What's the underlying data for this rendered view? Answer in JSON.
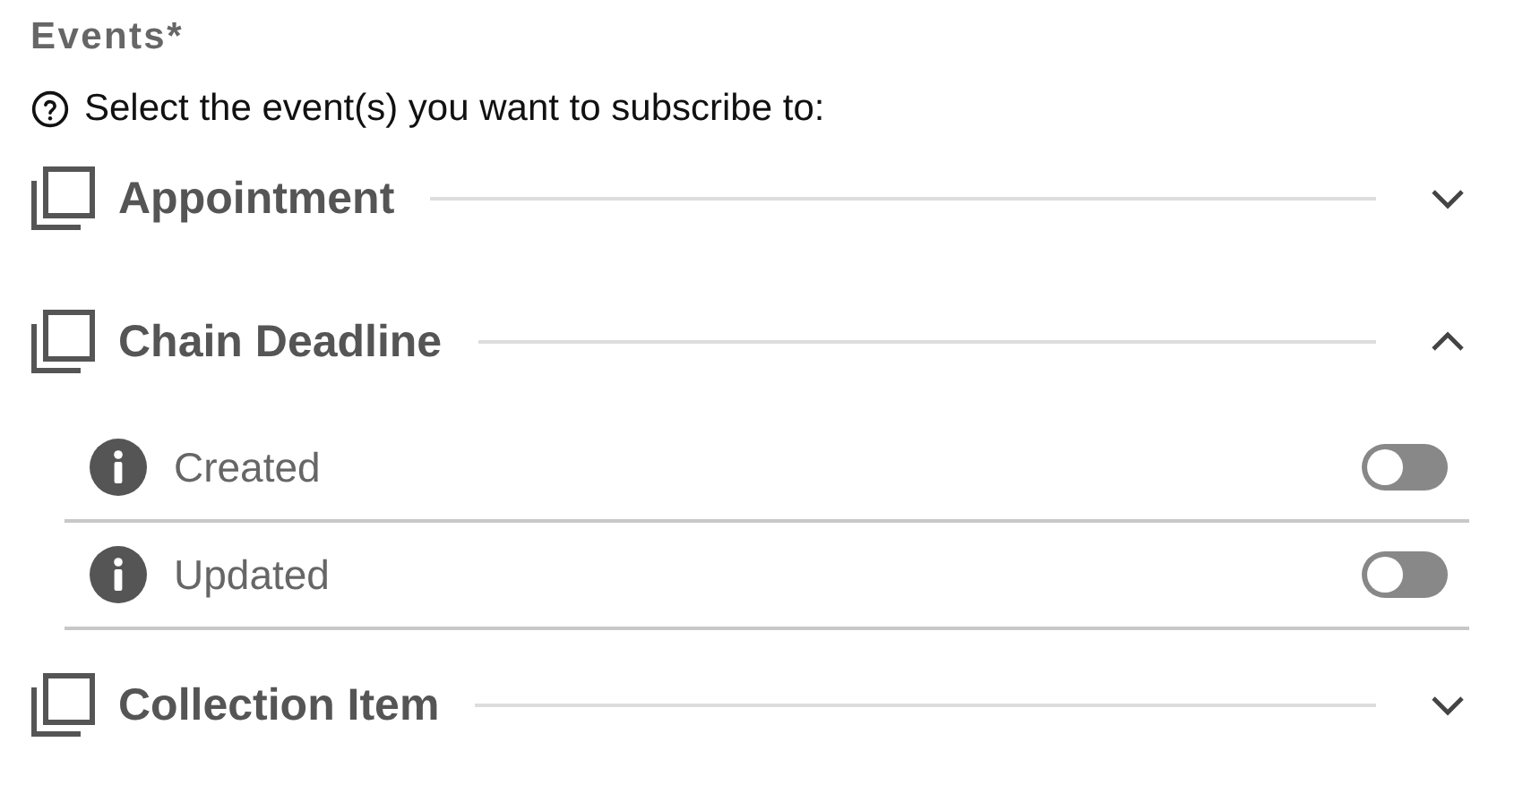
{
  "title": "Events*",
  "help_text": "Select the event(s) you want to subscribe to:",
  "groups": [
    {
      "label": "Appointment",
      "expanded": false
    },
    {
      "label": "Chain Deadline",
      "expanded": true,
      "items": [
        {
          "label": "Created",
          "on": false
        },
        {
          "label": "Updated",
          "on": false
        }
      ]
    },
    {
      "label": "Collection Item",
      "expanded": false
    }
  ]
}
